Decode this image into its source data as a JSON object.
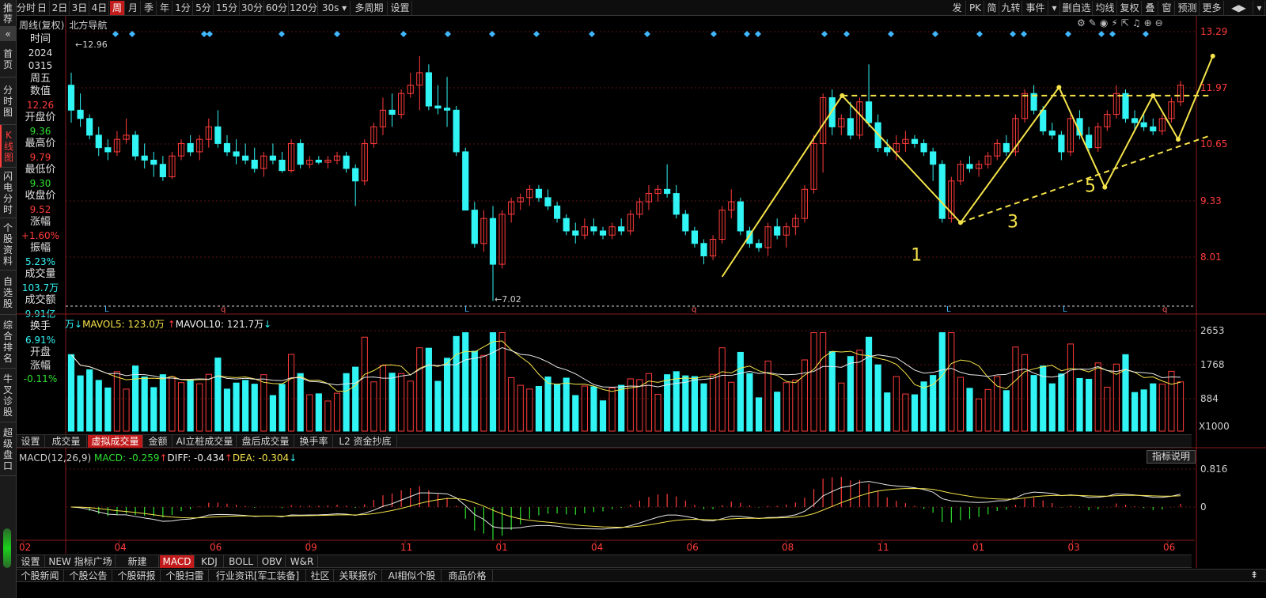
{
  "sidebar": {
    "items": [
      {
        "label": "推荐"
      },
      {
        "label": "首页"
      },
      {
        "label": "分时图"
      },
      {
        "label": "K线图",
        "active": true
      },
      {
        "label": "闪电分时"
      },
      {
        "label": "个股资料"
      },
      {
        "label": "自选股"
      },
      {
        "label": "综合排名"
      },
      {
        "label": "牛叉诊股"
      },
      {
        "label": "超级盘口"
      }
    ]
  },
  "toolbar": {
    "left": [
      "分时",
      "日",
      "2日",
      "3日",
      "4日",
      "周",
      "月",
      "季",
      "年",
      "1分",
      "5分",
      "15分",
      "30分",
      "60分",
      "120分",
      "30s ▾",
      "多周期",
      "设置"
    ],
    "active": "周",
    "right": [
      "发",
      "PK",
      "简",
      "九转",
      "事件",
      "▾",
      "删自选",
      "均线",
      "复权",
      "叠",
      "窗",
      "预测",
      "更多",
      "◀▶",
      "▾"
    ]
  },
  "header": {
    "period": "周线(复权)",
    "stock": "北方导航"
  },
  "data_panel": {
    "rows": [
      {
        "label": "时间",
        "value": "2024",
        "value2": "0315",
        "color": "white"
      },
      {
        "label": "周五",
        "value": "",
        "color": "white"
      },
      {
        "label": "数值",
        "value": "12.26",
        "color": "red"
      },
      {
        "label": "开盘价",
        "value": "9.36",
        "color": "green"
      },
      {
        "label": "最高价",
        "value": "9.79",
        "color": "red"
      },
      {
        "label": "最低价",
        "value": "9.30",
        "color": "green"
      },
      {
        "label": "收盘价",
        "value": "9.52",
        "color": "red"
      },
      {
        "label": "涨幅",
        "value": "+1.60%",
        "color": "red"
      },
      {
        "label": "振幅",
        "value": "5.23%",
        "color": "cyan"
      },
      {
        "label": "成交量",
        "value": "103.7万",
        "color": "cyan"
      },
      {
        "label": "成交额",
        "value": "9.91亿",
        "color": "cyan"
      },
      {
        "label": "换手",
        "value": "6.91%",
        "color": "cyan"
      },
      {
        "label": "开盘涨幅",
        "value": "-0.11%",
        "color": "green"
      }
    ]
  },
  "price_axis": [
    "13.29",
    "11.97",
    "10.65",
    "9.33",
    "8.01"
  ],
  "chart_data": [
    {
      "type": "candlestick",
      "title": "周线(复权) 北方导航",
      "high_marker": "12.96",
      "low_marker": "7.02",
      "price_range": [
        6.8,
        13.6
      ],
      "up_color": "#ff3b3b",
      "down_color": "#31f4f4",
      "candles": [
        [
          12.2,
          12.5,
          11.3,
          11.6
        ],
        [
          11.6,
          12.0,
          11.2,
          11.4
        ],
        [
          11.4,
          11.5,
          10.9,
          11.0
        ],
        [
          11.0,
          11.2,
          10.5,
          10.7
        ],
        [
          10.7,
          10.9,
          10.4,
          10.6
        ],
        [
          10.6,
          11.1,
          10.5,
          10.9
        ],
        [
          10.9,
          11.4,
          10.8,
          11.0
        ],
        [
          11.0,
          11.1,
          10.4,
          10.5
        ],
        [
          10.5,
          10.8,
          10.2,
          10.4
        ],
        [
          10.4,
          10.6,
          10.0,
          10.3
        ],
        [
          10.3,
          10.5,
          9.9,
          10.0
        ],
        [
          10.0,
          10.6,
          9.95,
          10.5
        ],
        [
          10.5,
          10.9,
          10.4,
          10.8
        ],
        [
          10.8,
          11.0,
          10.5,
          10.6
        ],
        [
          10.6,
          11.0,
          10.4,
          10.9
        ],
        [
          10.9,
          11.4,
          10.7,
          11.2
        ],
        [
          11.2,
          11.6,
          10.7,
          10.8
        ],
        [
          10.8,
          11.0,
          10.5,
          10.6
        ],
        [
          10.6,
          10.9,
          10.3,
          10.5
        ],
        [
          10.5,
          10.8,
          10.3,
          10.4
        ],
        [
          10.4,
          10.7,
          10.1,
          10.2
        ],
        [
          10.2,
          10.6,
          10.0,
          10.5
        ],
        [
          10.5,
          10.8,
          10.3,
          10.4
        ],
        [
          10.4,
          10.6,
          10.1,
          10.15
        ],
        [
          10.15,
          10.9,
          10.1,
          10.8
        ],
        [
          10.8,
          10.9,
          10.2,
          10.3
        ],
        [
          10.3,
          10.5,
          10.2,
          10.4
        ],
        [
          10.4,
          10.5,
          10.3,
          10.35
        ],
        [
          10.35,
          10.5,
          10.2,
          10.4
        ],
        [
          10.4,
          10.6,
          10.3,
          10.5
        ],
        [
          10.5,
          10.6,
          10.1,
          10.2
        ],
        [
          10.2,
          10.3,
          9.3,
          9.9
        ],
        [
          9.9,
          10.9,
          9.8,
          10.8
        ],
        [
          10.8,
          11.3,
          10.7,
          11.2
        ],
        [
          11.2,
          11.9,
          11.0,
          11.6
        ],
        [
          11.6,
          12.0,
          11.2,
          11.5
        ],
        [
          11.5,
          12.1,
          11.4,
          12.0
        ],
        [
          12.0,
          12.5,
          11.9,
          12.2
        ],
        [
          12.2,
          12.9,
          11.6,
          12.5
        ],
        [
          12.5,
          12.7,
          11.6,
          11.7
        ],
        [
          11.7,
          12.2,
          11.5,
          11.65
        ],
        [
          11.65,
          12.4,
          11.2,
          11.6
        ],
        [
          11.6,
          11.7,
          10.5,
          10.6
        ],
        [
          10.6,
          10.7,
          9.5,
          9.2
        ],
        [
          9.2,
          9.4,
          8.3,
          8.4
        ],
        [
          8.4,
          9.2,
          8.2,
          9.0
        ],
        [
          9.0,
          9.3,
          7.02,
          7.9
        ],
        [
          7.9,
          9.2,
          7.8,
          9.1
        ],
        [
          9.1,
          9.5,
          8.9,
          9.4
        ],
        [
          9.4,
          9.6,
          9.2,
          9.5
        ],
        [
          9.5,
          9.8,
          9.3,
          9.7
        ],
        [
          9.7,
          9.8,
          9.4,
          9.5
        ],
        [
          9.5,
          9.7,
          9.2,
          9.3
        ],
        [
          9.3,
          9.4,
          8.9,
          9.0
        ],
        [
          9.0,
          9.1,
          8.6,
          8.7
        ],
        [
          8.7,
          8.9,
          8.4,
          8.6
        ],
        [
          8.6,
          9.0,
          8.5,
          8.8
        ],
        [
          8.8,
          9.0,
          8.6,
          8.7
        ],
        [
          8.7,
          8.8,
          8.5,
          8.6
        ],
        [
          8.6,
          8.9,
          8.5,
          8.8
        ],
        [
          8.8,
          9.0,
          8.6,
          8.7
        ],
        [
          8.7,
          9.2,
          8.6,
          9.1
        ],
        [
          9.1,
          9.5,
          9.0,
          9.4
        ],
        [
          9.4,
          9.8,
          9.2,
          9.6
        ],
        [
          9.6,
          9.8,
          9.4,
          9.7
        ],
        [
          9.7,
          10.3,
          9.5,
          9.6
        ],
        [
          9.6,
          9.8,
          9.0,
          9.1
        ],
        [
          9.1,
          9.2,
          8.6,
          8.7
        ],
        [
          8.7,
          8.8,
          8.3,
          8.4
        ],
        [
          8.4,
          8.5,
          7.9,
          8.1
        ],
        [
          8.1,
          8.6,
          8.0,
          8.5
        ],
        [
          8.5,
          9.3,
          8.4,
          9.2
        ],
        [
          9.2,
          9.7,
          9.0,
          9.4
        ],
        [
          9.4,
          9.5,
          8.6,
          8.7
        ],
        [
          8.7,
          8.8,
          8.3,
          8.4
        ],
        [
          8.4,
          8.5,
          8.2,
          8.3
        ],
        [
          8.3,
          8.9,
          8.1,
          8.8
        ],
        [
          8.8,
          9.0,
          8.5,
          8.6
        ],
        [
          8.6,
          8.9,
          8.3,
          8.8
        ],
        [
          8.8,
          9.1,
          8.6,
          9.0
        ],
        [
          9.0,
          9.8,
          8.9,
          9.7
        ],
        [
          9.7,
          11.0,
          9.6,
          10.8
        ],
        [
          10.8,
          12.0,
          10.1,
          11.9
        ],
        [
          11.9,
          12.1,
          11.0,
          11.2
        ],
        [
          11.2,
          11.5,
          11.0,
          11.4
        ],
        [
          11.4,
          11.8,
          10.9,
          11.0
        ],
        [
          11.0,
          11.9,
          10.9,
          11.8
        ],
        [
          11.8,
          12.7,
          11.2,
          11.3
        ],
        [
          11.3,
          11.5,
          10.6,
          10.7
        ],
        [
          10.7,
          10.9,
          10.5,
          10.6
        ],
        [
          10.6,
          11.0,
          10.4,
          10.8
        ],
        [
          10.8,
          11.1,
          10.6,
          10.9
        ],
        [
          10.9,
          11.0,
          10.7,
          10.8
        ],
        [
          10.8,
          10.9,
          10.5,
          10.6
        ],
        [
          10.6,
          10.7,
          9.9,
          10.3
        ],
        [
          10.3,
          10.4,
          8.9,
          9.0
        ],
        [
          9.0,
          10.0,
          8.9,
          9.9
        ],
        [
          9.9,
          10.4,
          9.8,
          10.3
        ],
        [
          10.3,
          10.5,
          10.1,
          10.2
        ],
        [
          10.2,
          10.4,
          10.0,
          10.3
        ],
        [
          10.3,
          10.6,
          10.2,
          10.5
        ],
        [
          10.5,
          10.9,
          10.4,
          10.8
        ],
        [
          10.8,
          11.0,
          10.5,
          10.6
        ],
        [
          10.6,
          11.5,
          10.5,
          11.4
        ],
        [
          11.4,
          12.1,
          11.3,
          12.0
        ],
        [
          12.0,
          12.2,
          11.5,
          11.6
        ],
        [
          11.6,
          11.7,
          11.0,
          11.1
        ],
        [
          11.1,
          11.3,
          10.9,
          11.0
        ],
        [
          11.0,
          11.1,
          10.4,
          10.6
        ],
        [
          10.6,
          11.5,
          10.5,
          11.4
        ],
        [
          11.4,
          11.6,
          10.9,
          11.0
        ],
        [
          11.0,
          11.2,
          10.6,
          10.7
        ],
        [
          10.7,
          11.3,
          10.6,
          11.2
        ],
        [
          11.2,
          11.6,
          11.1,
          11.5
        ],
        [
          11.5,
          12.2,
          11.4,
          12.0
        ],
        [
          12.0,
          12.1,
          11.3,
          11.4
        ],
        [
          11.4,
          11.6,
          11.1,
          11.3
        ],
        [
          11.3,
          11.5,
          11.1,
          11.2
        ],
        [
          11.2,
          11.4,
          11.0,
          11.1
        ],
        [
          11.1,
          11.5,
          11.0,
          11.4
        ],
        [
          11.4,
          11.9,
          11.3,
          11.8
        ],
        [
          11.8,
          12.3,
          11.7,
          12.2
        ]
      ],
      "markers": [
        {
          "text": "1",
          "price": 8.1,
          "at": 0.758
        },
        {
          "text": "3",
          "price": 8.9,
          "at": 0.845
        },
        {
          "text": "5",
          "price": 9.75,
          "at": 0.915
        }
      ]
    },
    {
      "type": "bar",
      "title": "虚拟成交量",
      "legend": {
        "unit": "万",
        "mavol5_label": "MAVOL5: 123.0万",
        "mavol10_label": "MAVOL10: 121.7万"
      },
      "axis": [
        "2653",
        "1768",
        "884",
        "X1000"
      ],
      "ylim": [
        0,
        2750
      ]
    },
    {
      "type": "bar",
      "title": "MACD(12,26,9)",
      "legend": {
        "macd_label": "MACD: -0.259",
        "diff_label": "DIFF: -0.434",
        "dea_label": "DEA: -0.304"
      },
      "axis": [
        "0.816",
        "0"
      ],
      "x_ticks": [
        "02",
        "04",
        "06",
        "09",
        "11",
        "01",
        "04",
        "06",
        "08",
        "11",
        "01",
        "03",
        "06"
      ]
    }
  ],
  "vol_tabs": [
    "设置",
    "成交量",
    "虚拟成交量",
    "金额",
    "AI立桩成交量",
    "盘后成交量",
    "换手率",
    "L2 资金抄底"
  ],
  "vol_tab_active": "虚拟成交量",
  "indicator_btn": "指标说明",
  "ind_tabs": [
    "设置",
    "NEW 指标广场",
    "新建",
    "MACD",
    "KDJ",
    "BOLL",
    "OBV",
    "W&R"
  ],
  "ind_tab_active": "MACD",
  "bottom_tabs": [
    "个股新闻",
    "个股公告",
    "个股研报",
    "个股扫雷",
    "行业资讯[军工装备]",
    "社区",
    "关联报价",
    "AI相似个股",
    "商品价格"
  ]
}
